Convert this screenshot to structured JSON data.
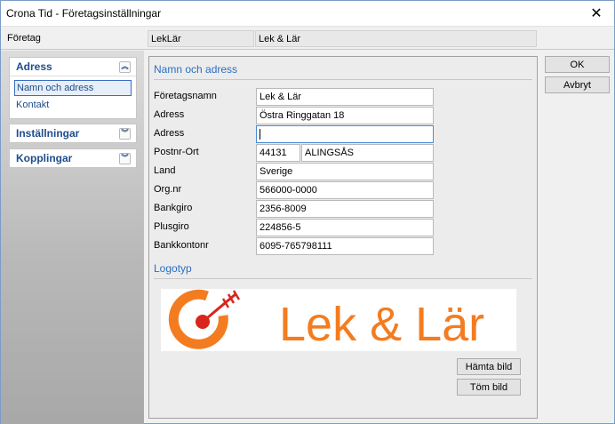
{
  "window": {
    "title": "Crona Tid - Företagsinställningar",
    "close_glyph": "✕"
  },
  "company_bar": {
    "label": "Företag",
    "code": "LekLär",
    "name": "Lek & Lär"
  },
  "sidebar": {
    "panels": [
      {
        "title": "Adress",
        "chevron": "up",
        "items": [
          {
            "label": "Namn och adress",
            "active": true
          },
          {
            "label": "Kontakt",
            "active": false
          }
        ]
      },
      {
        "title": "Inställningar",
        "chevron": "down",
        "items": []
      },
      {
        "title": "Kopplingar",
        "chevron": "down",
        "items": []
      }
    ]
  },
  "form": {
    "section_title": "Namn och adress",
    "fields": {
      "foretagsnamn": {
        "label": "Företagsnamn",
        "value": "Lek & Lär"
      },
      "adress1": {
        "label": "Adress",
        "value": "Östra Ringgatan 18"
      },
      "adress2": {
        "label": "Adress",
        "value": ""
      },
      "postnr_ort": {
        "label": "Postnr-Ort",
        "postnr": "44131",
        "ort": "ALINGSÅS"
      },
      "land": {
        "label": "Land",
        "value": "Sverige"
      },
      "orgnr": {
        "label": "Org.nr",
        "value": "566000-0000"
      },
      "bankgiro": {
        "label": "Bankgiro",
        "value": "2356-8009"
      },
      "plusgiro": {
        "label": "Plusgiro",
        "value": "224856-5"
      },
      "bankkontonr": {
        "label": "Bankkontonr",
        "value": "6095-765798111"
      }
    }
  },
  "logo_section": {
    "title": "Logotyp",
    "logo_text": "Lek & Lär",
    "logo_color": "#f47c20",
    "logo_accent": "#d9251c",
    "fetch_button": "Hämta bild",
    "clear_button": "Töm bild"
  },
  "actions": {
    "ok": "OK",
    "cancel": "Avbryt"
  },
  "colors": {
    "accent_blue": "#2b6fc2",
    "nav_blue": "#1e4d8c"
  }
}
